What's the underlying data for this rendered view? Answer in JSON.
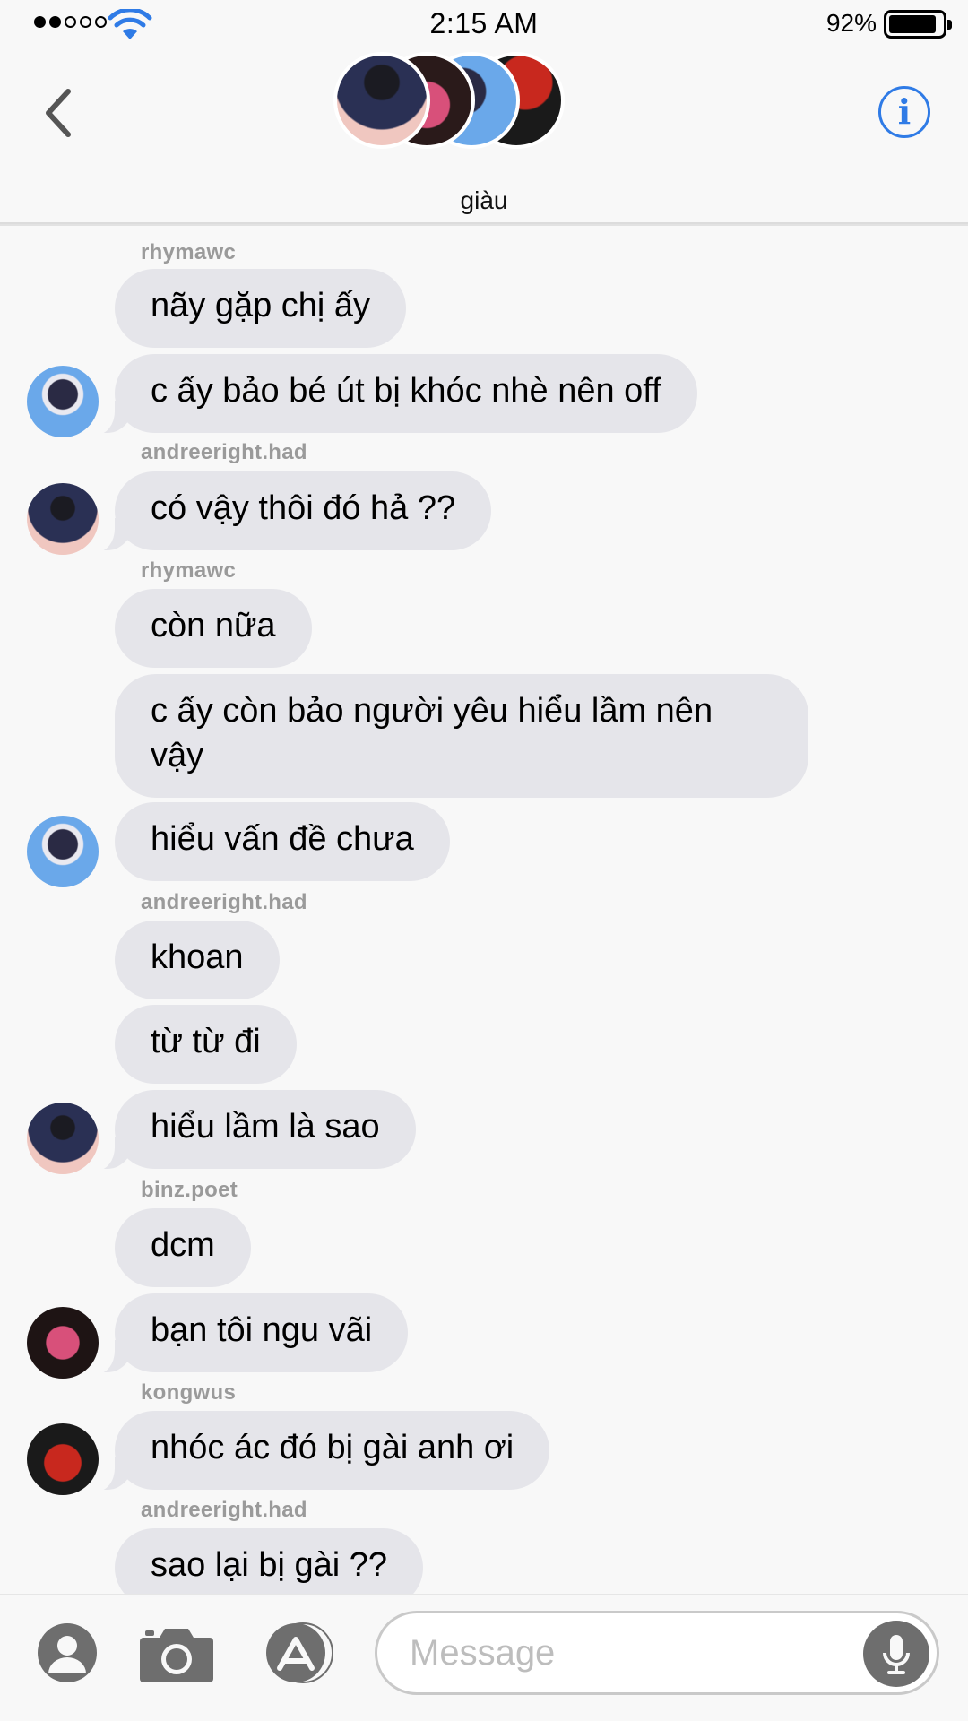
{
  "status_bar": {
    "time": "2:15 AM",
    "battery": "92%"
  },
  "header": {
    "title": "giàu"
  },
  "messages": [
    {
      "sender": "rhymawc",
      "text": "nãy gặp chị ấy"
    },
    {
      "text": "c ấy bảo bé út bị khóc nhè nên off"
    },
    {
      "sender": "andreeright.had",
      "text": "có vậy thôi đó hả ??"
    },
    {
      "sender": "rhymawc",
      "text": "còn nữa"
    },
    {
      "text": "c ấy còn bảo người yêu hiểu lầm nên vậy"
    },
    {
      "text": "hiểu vấn đề chưa"
    },
    {
      "sender": "andreeright.had",
      "text": "khoan"
    },
    {
      "text": "từ từ đi"
    },
    {
      "text": "hiểu lầm là sao"
    },
    {
      "sender": "binz.poet",
      "text": "dcm"
    },
    {
      "text": "bạn tôi ngu vãi"
    },
    {
      "sender": "kongwus",
      "text": "nhóc ác đó bị gài anh ơi"
    },
    {
      "sender": "andreeright.had",
      "text": "sao lại bị gài ??"
    }
  ],
  "input": {
    "placeholder": "Message"
  },
  "icons": [
    "back-chevron-icon",
    "info-icon",
    "contact-icon",
    "camera-icon",
    "app-store-icon",
    "microphone-icon",
    "wifi-icon"
  ],
  "colors": {
    "accent": "#2f7be6",
    "bubble": "#e5e5ea",
    "background": "#f8f8f8",
    "sender": "#9a9a9a"
  }
}
